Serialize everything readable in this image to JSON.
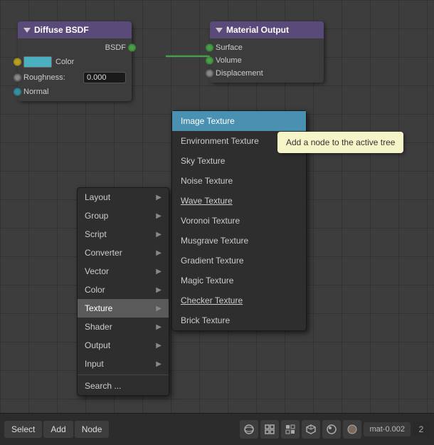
{
  "canvas": {
    "bg_color": "#3d3d3d"
  },
  "nodes": {
    "diffuse": {
      "title": "Diffuse BSDF",
      "socket_bsdf": "BSDF",
      "socket_color": "Color",
      "socket_roughness": "Roughness:",
      "roughness_value": "0.000",
      "socket_normal": "Normal"
    },
    "material": {
      "title": "Material Output",
      "socket_surface": "Surface",
      "socket_volume": "Volume",
      "socket_displacement": "Displacement"
    }
  },
  "left_menu": {
    "items": [
      {
        "label": "Layout",
        "has_arrow": true,
        "active": false
      },
      {
        "label": "Group",
        "has_arrow": true,
        "active": false
      },
      {
        "label": "Script",
        "has_arrow": true,
        "active": false
      },
      {
        "label": "Converter",
        "has_arrow": true,
        "active": false
      },
      {
        "label": "Vector",
        "has_arrow": true,
        "active": false
      },
      {
        "label": "Color",
        "has_arrow": true,
        "active": false
      },
      {
        "label": "Texture",
        "has_arrow": true,
        "active": true
      },
      {
        "label": "Shader",
        "has_arrow": true,
        "active": false
      },
      {
        "label": "Output",
        "has_arrow": true,
        "active": false
      },
      {
        "label": "Input",
        "has_arrow": true,
        "active": false
      },
      {
        "label": "Search ...",
        "has_arrow": false,
        "active": false
      }
    ]
  },
  "texture_menu": {
    "items": [
      {
        "label": "Image Texture",
        "highlighted": true
      },
      {
        "label": "Environment Texture",
        "highlighted": false
      },
      {
        "label": "Sky Texture",
        "highlighted": false
      },
      {
        "label": "Noise Texture",
        "highlighted": false
      },
      {
        "label": "Wave Texture",
        "highlighted": false
      },
      {
        "label": "Voronoi Texture",
        "highlighted": false
      },
      {
        "label": "Musgrave Texture",
        "highlighted": false
      },
      {
        "label": "Gradient Texture",
        "highlighted": false
      },
      {
        "label": "Magic Texture",
        "highlighted": false
      },
      {
        "label": "Checker Texture",
        "highlighted": false
      },
      {
        "label": "Brick Texture",
        "highlighted": false
      }
    ]
  },
  "tooltip": {
    "text": "Add a node to the active tree"
  },
  "toolbar": {
    "select_label": "Select",
    "add_label": "Add",
    "node_label": "Node",
    "mat_label": "mat-0.002",
    "num_label": "2"
  }
}
